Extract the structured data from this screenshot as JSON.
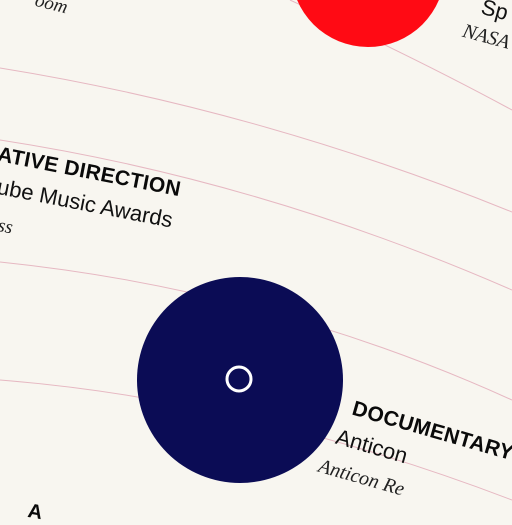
{
  "colors": {
    "background": "#f8f6f0",
    "arc_line": "#e6b8c2",
    "red_dot": "#ff0a14",
    "navy_dot": "#0b0c55",
    "ring": "#ffffff"
  },
  "entries": {
    "top_partial_client": "oom",
    "top_right_name": "Sp",
    "top_right_client": "NASA",
    "creative": {
      "category": "ATIVE DIRECTION",
      "name": "ube Music Awards",
      "client": "ss"
    },
    "documentary": {
      "category": "DOCUMENTARY",
      "name": "Anticon",
      "client": "Anticon Re"
    },
    "bottom_partial_category": "A"
  }
}
